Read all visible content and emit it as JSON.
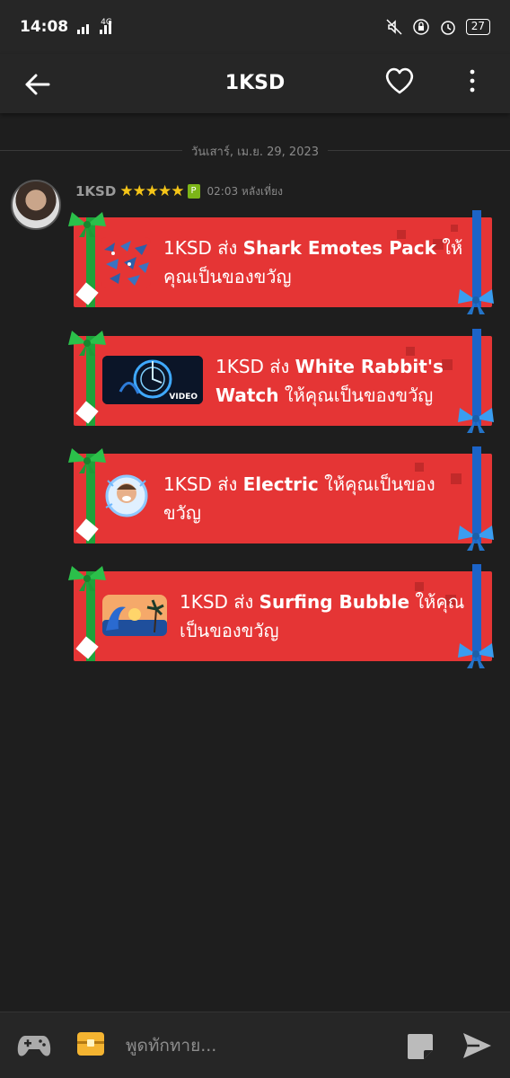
{
  "status_bar": {
    "time": "14:08",
    "network": "4G",
    "battery": "27"
  },
  "header": {
    "title": "1KSD"
  },
  "chat": {
    "date_separator": "วันเสาร์, เม.ย. 29, 2023",
    "sender": {
      "name": "1KSD",
      "stars": "★★★★★",
      "level": "P",
      "time": "02:03 หลังเที่ยง"
    },
    "gifts": [
      {
        "sender": "1KSD",
        "verb": "ส่ง",
        "item": "Shark Emotes Pack",
        "suffix": "ให้คุณเป็นของขวัญ",
        "thumb_icon": "shark-emotes-icon"
      },
      {
        "sender": "1KSD",
        "verb": "ส่ง",
        "item": "White Rabbit's Watch",
        "suffix": "ให้คุณเป็นของขวัญ",
        "thumb_icon": "video-thumbnail-icon",
        "thumb_badge": "VIDEO"
      },
      {
        "sender": "1KSD",
        "verb": "ส่ง",
        "item": "Electric",
        "suffix": "ให้คุณเป็นของขวัญ",
        "thumb_icon": "avatar-frame-icon"
      },
      {
        "sender": "1KSD",
        "verb": "ส่ง",
        "item": "Surfing Bubble",
        "suffix": "ให้คุณเป็นของขวัญ",
        "thumb_icon": "surfing-bubble-icon"
      }
    ]
  },
  "composer": {
    "placeholder": "พูดทักทาย..."
  },
  "colors": {
    "background": "#1e1e1e",
    "bar": "#262626",
    "gift_red": "#e53535",
    "ribbon_green": "#1ea23a",
    "ribbon_blue": "#1c64c8",
    "star_gold": "#f5c518"
  }
}
